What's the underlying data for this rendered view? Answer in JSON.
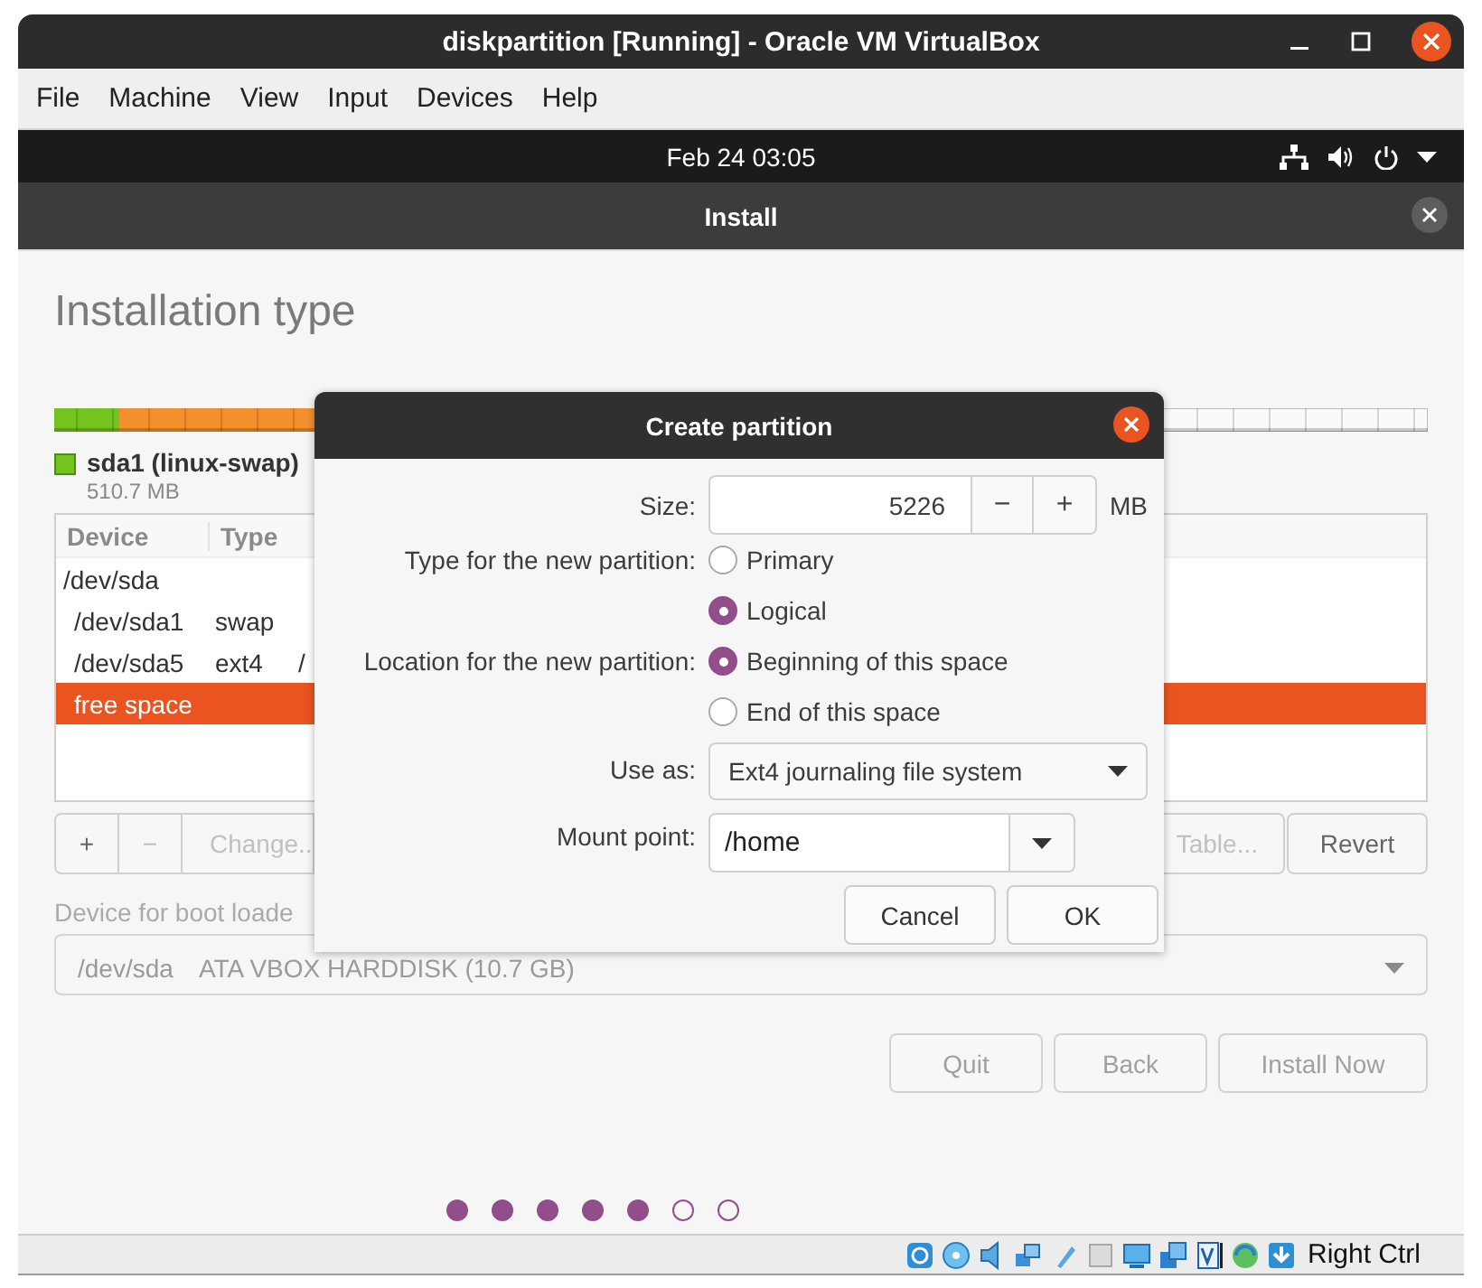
{
  "window": {
    "title": "diskpartition [Running] - Oracle VM VirtualBox"
  },
  "menu": [
    "File",
    "Machine",
    "View",
    "Input",
    "Devices",
    "Help"
  ],
  "top_bar": {
    "clock": "Feb 24  03:05"
  },
  "installer": {
    "title": "Install",
    "heading": "Installation type",
    "legend": {
      "name": "sda1 (linux-swap)",
      "size": "510.7 MB"
    },
    "table": {
      "columns": [
        "Device",
        "Type"
      ],
      "rows": [
        {
          "device": "/dev/sda",
          "selected": false,
          "children": [
            {
              "device": "/dev/sda1",
              "type": "swap",
              "selected": false
            },
            {
              "device": "/dev/sda5",
              "type": "ext4",
              "mount": "/",
              "selected": false
            },
            {
              "device": "free space",
              "selected": true
            }
          ]
        }
      ]
    },
    "partition_buttons": [
      {
        "label": "+",
        "disabled": false
      },
      {
        "label": "−",
        "disabled": true
      },
      {
        "label": "Change..",
        "disabled": true
      },
      {
        "label": "Table...",
        "disabled": true
      },
      {
        "label": "Revert",
        "disabled": false
      }
    ],
    "boot_loader": {
      "label": "Device for boot loade",
      "device": "/dev/sda",
      "description": "ATA VBOX HARDDISK (10.7 GB)"
    },
    "nav_buttons": [
      "Quit",
      "Back",
      "Install Now"
    ],
    "progress_dots": [
      {
        "filled": true
      },
      {
        "filled": true
      },
      {
        "filled": true
      },
      {
        "filled": true
      },
      {
        "filled": true
      },
      {
        "filled": false
      },
      {
        "filled": false
      }
    ]
  },
  "dialog": {
    "title": "Create partition",
    "size": {
      "label": "Size:",
      "value": "5226",
      "decrement": "−",
      "increment": "+",
      "unit": "MB"
    },
    "type": {
      "label": "Type for the new partition:",
      "options": [
        {
          "label": "Primary",
          "selected": false
        },
        {
          "label": "Logical",
          "selected": true
        }
      ]
    },
    "location": {
      "label": "Location for the new partition:",
      "options": [
        {
          "label": "Beginning of this space",
          "selected": true
        },
        {
          "label": "End of this space",
          "selected": false
        }
      ]
    },
    "use_as": {
      "label": "Use as:",
      "value": "Ext4 journaling file system"
    },
    "mount_point": {
      "label": "Mount point:",
      "value": "/home"
    },
    "buttons": [
      "Cancel",
      "OK"
    ]
  },
  "status_bar": {
    "host_key": "Right Ctrl"
  }
}
